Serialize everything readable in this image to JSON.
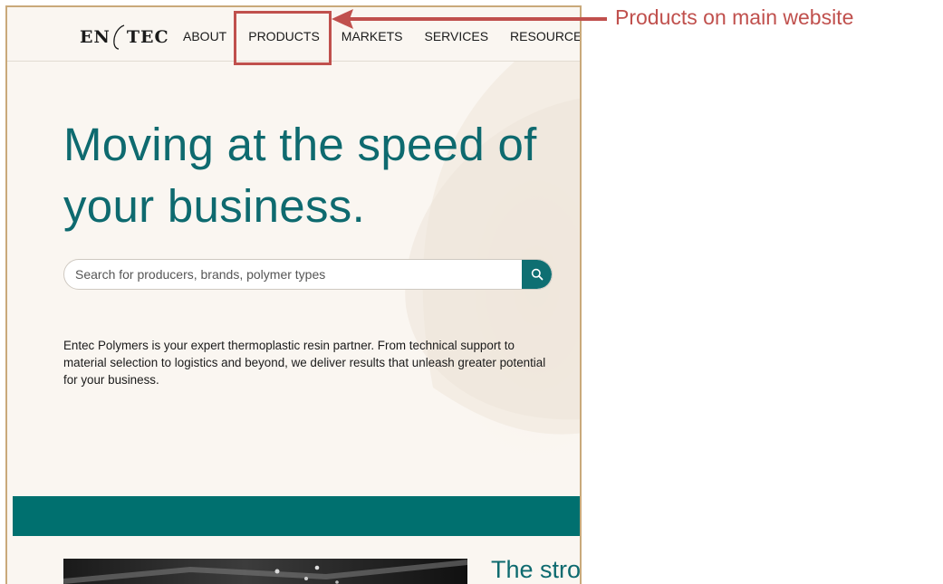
{
  "site": {
    "logo_left": "EN",
    "logo_right": "TEC",
    "nav": [
      "ABOUT",
      "PRODUCTS",
      "MARKETS",
      "SERVICES",
      "RESOURCES"
    ],
    "headline": "Moving at the speed of your business.",
    "search_placeholder": "Search for producers, brands, polymer types",
    "intro": "Entec Polymers is your expert thermoplastic resin partner. From technical support to material selection to logistics and beyond, we deliver results that unleash greater potential for your business.",
    "feature_heading": "The stro",
    "colors": {
      "brand_teal": "#0e6a6f",
      "band_teal": "#00706f",
      "background": "#faf6f1"
    }
  },
  "annotation": {
    "label": "Products on main website",
    "color": "#c0504d"
  },
  "icons": {
    "search": "search-icon",
    "logo_mark": "entec-logo-mark"
  }
}
